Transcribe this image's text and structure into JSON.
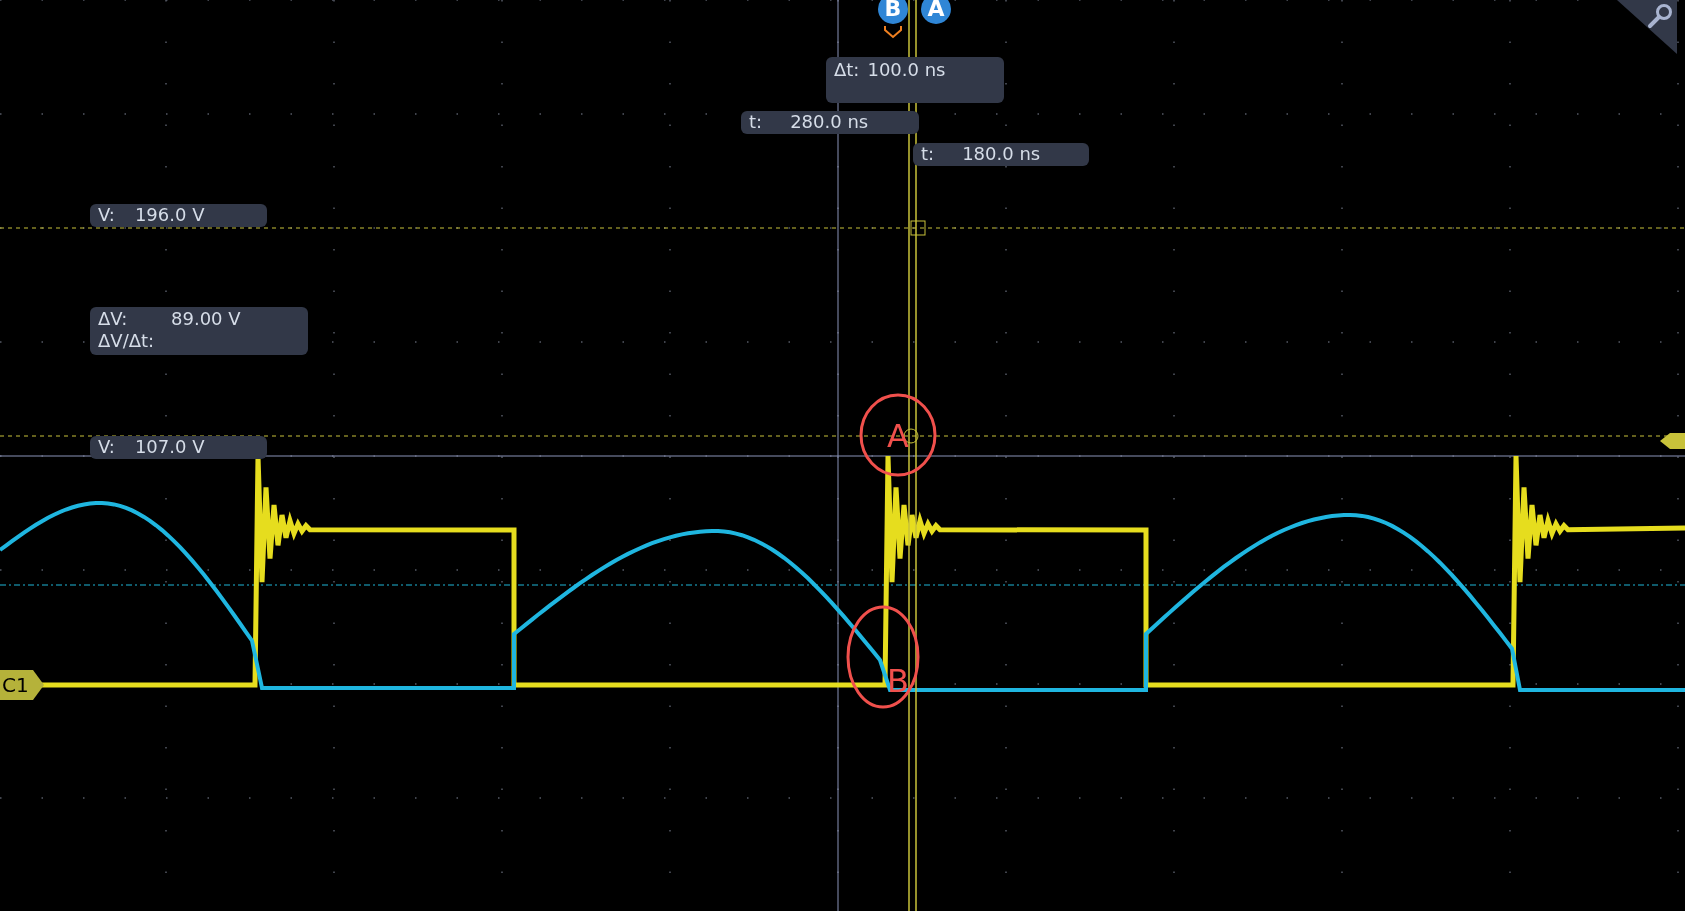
{
  "cursor_markers": [
    {
      "label": "B"
    },
    {
      "label": "A"
    }
  ],
  "delta_time": {
    "label": "Δt:",
    "value": "100.0 ns"
  },
  "cursor_times": [
    {
      "label": "t:",
      "value": "280.0 ns"
    },
    {
      "label": "t:",
      "value": "180.0 ns"
    }
  ],
  "cursor_voltages": [
    {
      "label": "V:",
      "value": "196.0 V"
    },
    {
      "label": "V:",
      "value": "107.0 V"
    }
  ],
  "delta_voltage": [
    {
      "label": "ΔV:",
      "value": "89.00 V"
    },
    {
      "label": "ΔV/Δt:"
    }
  ],
  "channel_badge": "C1",
  "annotations": [
    {
      "label": "A"
    },
    {
      "label": "B"
    }
  ]
}
